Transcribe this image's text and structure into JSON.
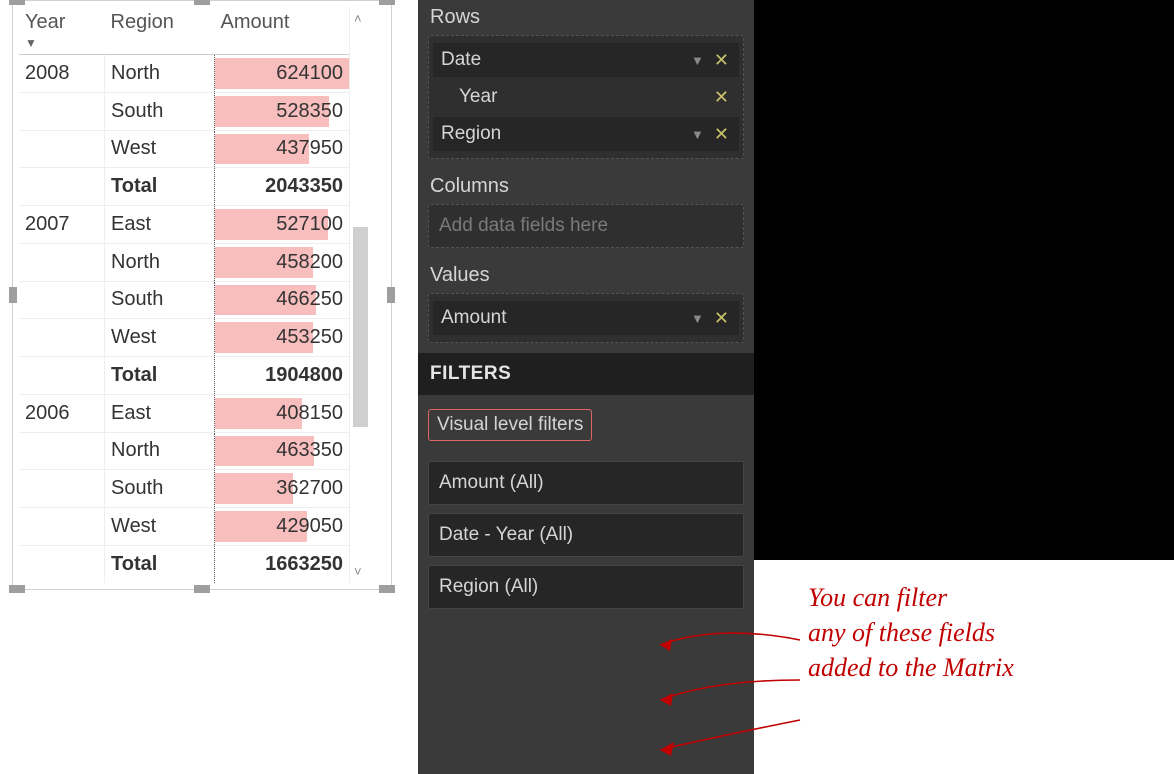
{
  "matrix": {
    "headers": {
      "year": "Year",
      "region": "Region",
      "amount": "Amount"
    },
    "max_amount": 624100,
    "groups": [
      {
        "year": "2008",
        "rows": [
          {
            "region": "North",
            "amount": 624100
          },
          {
            "region": "South",
            "amount": 528350
          },
          {
            "region": "West",
            "amount": 437950
          }
        ],
        "total_label": "Total",
        "total_amount": 2043350
      },
      {
        "year": "2007",
        "rows": [
          {
            "region": "East",
            "amount": 527100
          },
          {
            "region": "North",
            "amount": 458200
          },
          {
            "region": "South",
            "amount": 466250
          },
          {
            "region": "West",
            "amount": 453250
          }
        ],
        "total_label": "Total",
        "total_amount": 1904800
      },
      {
        "year": "2006",
        "rows": [
          {
            "region": "East",
            "amount": 408150
          },
          {
            "region": "North",
            "amount": 463350
          },
          {
            "region": "South",
            "amount": 362700
          },
          {
            "region": "West",
            "amount": 429050
          }
        ],
        "total_label": "Total",
        "total_amount": 1663250
      }
    ]
  },
  "panel": {
    "rows_label": "Rows",
    "rows_fields": {
      "date": "Date",
      "year": "Year",
      "region": "Region"
    },
    "columns_label": "Columns",
    "columns_placeholder": "Add data fields here",
    "values_label": "Values",
    "values_field": "Amount",
    "filters_header": "FILTERS",
    "visual_level_filters": "Visual level filters",
    "filter_items": {
      "amount": "Amount  (All)",
      "date_year": "Date - Year  (All)",
      "region": "Region  (All)"
    }
  },
  "annotation": {
    "line1": "You can filter",
    "line2": "any of these fields",
    "line3": "added to the Matrix"
  }
}
